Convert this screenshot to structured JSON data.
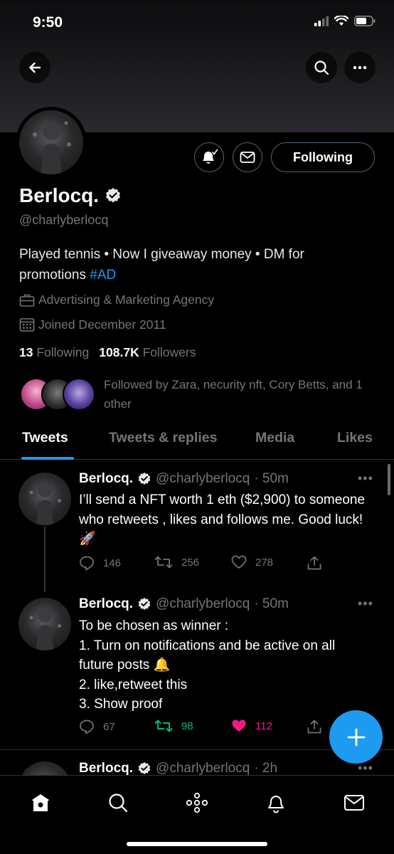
{
  "status_bar": {
    "time": "9:50"
  },
  "profile": {
    "name": "Berlocq.",
    "handle": "@charlyberlocq",
    "bio_text": "Played tennis • Now I giveaway money • DM for promotions ",
    "bio_hashtag": "#AD",
    "category": "Advertising & Marketing Agency",
    "joined": "Joined December 2011",
    "following_count": "13",
    "following_label": "Following",
    "followers_count": "108.7K",
    "followers_label": "Followers",
    "followed_by": "Followed by Zara, necurity nft, Cory Betts, and 1 other",
    "follow_button_label": "Following"
  },
  "tabs": [
    {
      "label": "Tweets",
      "active": true
    },
    {
      "label": "Tweets & replies",
      "active": false
    },
    {
      "label": "Media",
      "active": false
    },
    {
      "label": "Likes",
      "active": false
    }
  ],
  "tweets": [
    {
      "name": "Berlocq.",
      "handle": "@charlyberlocq",
      "time": "· 50m",
      "text": "I’ll send a NFT worth 1 eth ($2,900) to someone who retweets , likes and follows me. Good luck! 🚀",
      "replies": "146",
      "retweets": "256",
      "likes": "278",
      "retweeted": false,
      "liked": false
    },
    {
      "name": "Berlocq.",
      "handle": "@charlyberlocq",
      "time": "· 50m",
      "text_lines": [
        "To be chosen as winner :",
        "1. Turn on notifications and be active on all",
        "future posts 🔔",
        "2. like,retweet this",
        "3. Show proof"
      ],
      "replies": "67",
      "retweets": "98",
      "likes": "112",
      "retweeted": true,
      "liked": true
    },
    {
      "name": "Berlocq.",
      "handle": "@charlyberlocq",
      "time": "· 2h"
    }
  ],
  "colors": {
    "accent": "#1d9bf0",
    "retweet_active": "#00ba7c",
    "like_active": "#f91880",
    "muted": "#71767b"
  },
  "icons": {
    "back": "arrow-left-icon",
    "search": "search-icon",
    "more": "more-icon",
    "notify": "bell-check-icon",
    "message": "envelope-icon",
    "verified": "verified-badge-icon",
    "category": "briefcase-icon",
    "joined": "calendar-icon",
    "reply": "reply-icon",
    "retweet": "retweet-icon",
    "like": "heart-icon",
    "share": "share-icon",
    "compose": "plus-icon",
    "nav_home": "home-icon",
    "nav_search": "search-icon",
    "nav_spaces": "spaces-icon",
    "nav_notifications": "bell-icon",
    "nav_messages": "envelope-icon"
  }
}
